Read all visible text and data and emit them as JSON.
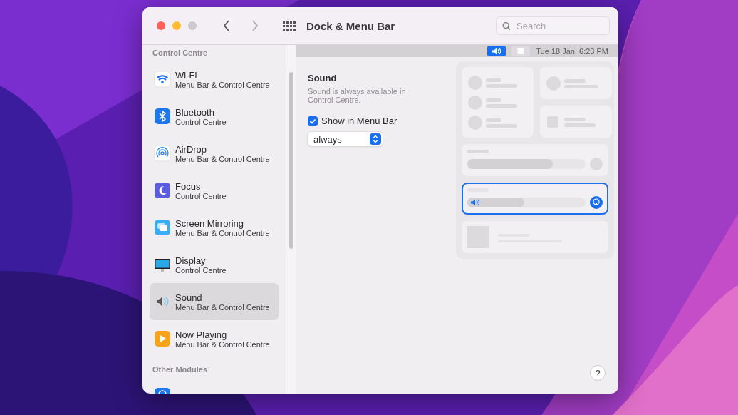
{
  "window": {
    "title": "Dock & Menu Bar"
  },
  "search": {
    "placeholder": "Search"
  },
  "sidebar": {
    "sections": [
      {
        "title": "Control Centre",
        "items": [
          {
            "kind": "wifi",
            "label": "Wi-Fi",
            "subtitle": "Menu Bar & Control Centre",
            "selected": false
          },
          {
            "kind": "bluetooth",
            "label": "Bluetooth",
            "subtitle": "Control Centre",
            "selected": false
          },
          {
            "kind": "airdrop",
            "label": "AirDrop",
            "subtitle": "Menu Bar & Control Centre",
            "selected": false
          },
          {
            "kind": "focus",
            "label": "Focus",
            "subtitle": "Control Centre",
            "selected": false
          },
          {
            "kind": "mirroring",
            "label": "Screen Mirroring",
            "subtitle": "Menu Bar & Control Centre",
            "selected": false
          },
          {
            "kind": "display",
            "label": "Display",
            "subtitle": "Control Centre",
            "selected": false
          },
          {
            "kind": "sound",
            "label": "Sound",
            "subtitle": "Menu Bar & Control Centre",
            "selected": true
          },
          {
            "kind": "nowplaying",
            "label": "Now Playing",
            "subtitle": "Menu Bar & Control Centre",
            "selected": false
          }
        ]
      },
      {
        "title": "Other Modules",
        "items": [
          {
            "kind": "accessibility",
            "selected": false
          }
        ]
      }
    ]
  },
  "menu_bar_preview": {
    "items": [
      {
        "kind": "sound",
        "selected": true
      },
      {
        "kind": "controlcentre",
        "selected": false
      }
    ],
    "clock": "Tue 18 Jan  6:23 PM"
  },
  "detail": {
    "title": "Sound",
    "description": "Sound is always available in Control Centre.",
    "show_in_menu_bar": {
      "label": "Show in Menu Bar",
      "checked": true
    },
    "visibility": {
      "value": "always"
    }
  },
  "help": {
    "label": "?"
  }
}
